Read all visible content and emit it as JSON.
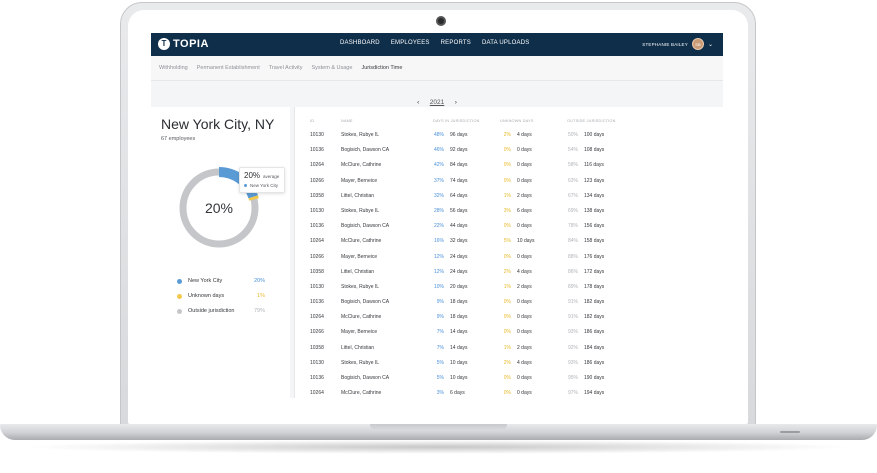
{
  "nav": {
    "brand": "TOPIA",
    "brand_mark": "T",
    "links": [
      "DASHBOARD",
      "EMPLOYEES",
      "REPORTS",
      "DATA UPLOADS"
    ],
    "user_name": "STEPHANIE BAILEY",
    "user_initials": "SB"
  },
  "subnav": {
    "items": [
      "Withholding",
      "Permanent Establishment",
      "Travel Activity",
      "System & Usage",
      "Jurisdiction Time"
    ],
    "active_index": 4
  },
  "year": {
    "prev": "‹",
    "value": "2021",
    "next": "›"
  },
  "summary": {
    "city": "New York City, NY",
    "employees": "67 employees",
    "donut_center": "20%",
    "tooltip_pct": "20%",
    "tooltip_avg": "average",
    "tooltip_city": "New York City",
    "legend": [
      {
        "label": "New York City",
        "value": "20%",
        "color": "#5b9bd5"
      },
      {
        "label": "Unknown days",
        "value": "1%",
        "color": "#f2c94c"
      },
      {
        "label": "Outside jurisdiction",
        "value": "79%",
        "color": "#c4c6c9"
      }
    ],
    "donut_fractions": {
      "in": 0.2,
      "unknown": 0.01,
      "outside": 0.79
    }
  },
  "table": {
    "headers": [
      "ID",
      "NAME",
      "DAYS IN JURISDICTION",
      "UNKNOWN DAYS",
      "OUTSIDE JURISDICTION"
    ],
    "rows": [
      {
        "id": "10130",
        "name": "Stokes, Rubye IL",
        "in_pct": "48%",
        "in_days": "96 days",
        "unk_pct": "2%",
        "unk_days": "4 days",
        "out_pct": "50%",
        "out_days": "100 days"
      },
      {
        "id": "10136",
        "name": "Bogisich, Dawson CA",
        "in_pct": "46%",
        "in_days": "92 days",
        "unk_pct": "0%",
        "unk_days": "0 days",
        "out_pct": "54%",
        "out_days": "108 days"
      },
      {
        "id": "10264",
        "name": "McClure, Cathrine",
        "in_pct": "42%",
        "in_days": "84 days",
        "unk_pct": "0%",
        "unk_days": "0 days",
        "out_pct": "58%",
        "out_days": "116 days"
      },
      {
        "id": "10266",
        "name": "Mayer, Berneice",
        "in_pct": "37%",
        "in_days": "74 days",
        "unk_pct": "0%",
        "unk_days": "0 days",
        "out_pct": "63%",
        "out_days": "123 days"
      },
      {
        "id": "10358",
        "name": "Littel, Christian",
        "in_pct": "32%",
        "in_days": "64 days",
        "unk_pct": "1%",
        "unk_days": "2 days",
        "out_pct": "67%",
        "out_days": "134 days"
      },
      {
        "id": "10130",
        "name": "Stokes, Rubye IL",
        "in_pct": "28%",
        "in_days": "56 days",
        "unk_pct": "3%",
        "unk_days": "6 days",
        "out_pct": "69%",
        "out_days": "138 days"
      },
      {
        "id": "10136",
        "name": "Bogisich, Dawson CA",
        "in_pct": "22%",
        "in_days": "44 days",
        "unk_pct": "0%",
        "unk_days": "0 days",
        "out_pct": "78%",
        "out_days": "156 days"
      },
      {
        "id": "10264",
        "name": "McClure, Cathrine",
        "in_pct": "16%",
        "in_days": "32 days",
        "unk_pct": "5%",
        "unk_days": "10 days",
        "out_pct": "84%",
        "out_days": "158 days"
      },
      {
        "id": "10266",
        "name": "Mayer, Berneice",
        "in_pct": "12%",
        "in_days": "24 days",
        "unk_pct": "0%",
        "unk_days": "0 days",
        "out_pct": "88%",
        "out_days": "176 days"
      },
      {
        "id": "10358",
        "name": "Littel, Christian",
        "in_pct": "12%",
        "in_days": "24 days",
        "unk_pct": "2%",
        "unk_days": "4 days",
        "out_pct": "86%",
        "out_days": "172 days"
      },
      {
        "id": "10130",
        "name": "Stokes, Rubye IL",
        "in_pct": "10%",
        "in_days": "20 days",
        "unk_pct": "1%",
        "unk_days": "2 days",
        "out_pct": "89%",
        "out_days": "178 days"
      },
      {
        "id": "10136",
        "name": "Bogisich, Dawson CA",
        "in_pct": "9%",
        "in_days": "18 days",
        "unk_pct": "0%",
        "unk_days": "0 days",
        "out_pct": "91%",
        "out_days": "182 days"
      },
      {
        "id": "10264",
        "name": "McClure, Cathrine",
        "in_pct": "9%",
        "in_days": "18 days",
        "unk_pct": "0%",
        "unk_days": "0 days",
        "out_pct": "91%",
        "out_days": "182 days"
      },
      {
        "id": "10266",
        "name": "Mayer, Berneice",
        "in_pct": "7%",
        "in_days": "14 days",
        "unk_pct": "0%",
        "unk_days": "0 days",
        "out_pct": "93%",
        "out_days": "186 days"
      },
      {
        "id": "10358",
        "name": "Littel, Christian",
        "in_pct": "7%",
        "in_days": "14 days",
        "unk_pct": "1%",
        "unk_days": "2 days",
        "out_pct": "92%",
        "out_days": "184 days"
      },
      {
        "id": "10130",
        "name": "Stokes, Rubye IL",
        "in_pct": "5%",
        "in_days": "10 days",
        "unk_pct": "2%",
        "unk_days": "4 days",
        "out_pct": "93%",
        "out_days": "186 days"
      },
      {
        "id": "10136",
        "name": "Bogisich, Dawson CA",
        "in_pct": "5%",
        "in_days": "10 days",
        "unk_pct": "0%",
        "unk_days": "0 days",
        "out_pct": "95%",
        "out_days": "190 days"
      },
      {
        "id": "10264",
        "name": "McClure, Cathrine",
        "in_pct": "3%",
        "in_days": "6 days",
        "unk_pct": "0%",
        "unk_days": "0 days",
        "out_pct": "97%",
        "out_days": "194 days"
      }
    ]
  },
  "colors": {
    "nav_bg": "#0e2e4a",
    "in_jurisdiction": "#5b9bd5",
    "unknown": "#f2c94c",
    "outside": "#c4c6c9"
  }
}
